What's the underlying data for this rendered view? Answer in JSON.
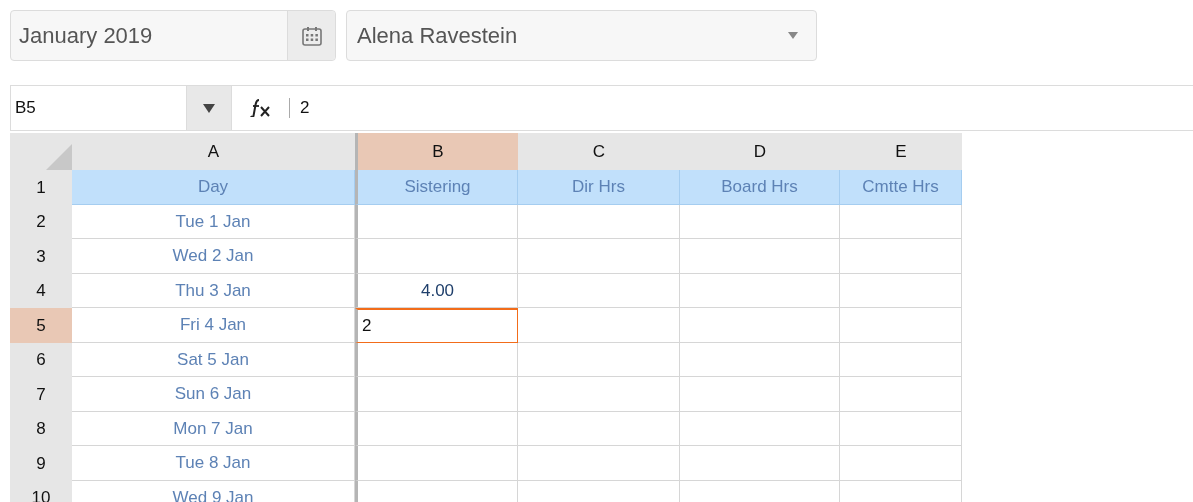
{
  "period_picker": {
    "value": "January 2019"
  },
  "person_select": {
    "value": "Alena Ravestein"
  },
  "formula_bar": {
    "cell_name": "B5",
    "formula": "2"
  },
  "columns": [
    {
      "letter": "A",
      "selected": false
    },
    {
      "letter": "B",
      "selected": true
    },
    {
      "letter": "C",
      "selected": false
    },
    {
      "letter": "D",
      "selected": false
    },
    {
      "letter": "E",
      "selected": false
    }
  ],
  "rows": [
    {
      "number": "1",
      "kind": "header",
      "selected": false,
      "cells": {
        "A": {
          "text": "Day",
          "selected": false
        },
        "B": {
          "text": "Sistering",
          "selected": false
        },
        "C": {
          "text": "Dir Hrs",
          "selected": false
        },
        "D": {
          "text": "Board Hrs",
          "selected": false
        },
        "E": {
          "text": "Cmtte Hrs",
          "selected": false
        }
      }
    },
    {
      "number": "2",
      "kind": "data",
      "selected": false,
      "cells": {
        "A": {
          "text": "Tue 1 Jan",
          "selected": false
        }
      }
    },
    {
      "number": "3",
      "kind": "data",
      "selected": false,
      "cells": {
        "A": {
          "text": "Wed 2 Jan",
          "selected": false
        }
      }
    },
    {
      "number": "4",
      "kind": "data",
      "selected": false,
      "cells": {
        "A": {
          "text": "Thu 3 Jan",
          "selected": false
        },
        "B": {
          "text": "4.00",
          "selected": false
        }
      }
    },
    {
      "number": "5",
      "kind": "data",
      "selected": true,
      "cells": {
        "A": {
          "text": "Fri 4 Jan",
          "selected": false
        },
        "B": {
          "text": "2",
          "selected": true
        }
      }
    },
    {
      "number": "6",
      "kind": "data",
      "selected": false,
      "cells": {
        "A": {
          "text": "Sat 5 Jan",
          "selected": false
        }
      }
    },
    {
      "number": "7",
      "kind": "data",
      "selected": false,
      "cells": {
        "A": {
          "text": "Sun 6 Jan",
          "selected": false
        }
      }
    },
    {
      "number": "8",
      "kind": "data",
      "selected": false,
      "cells": {
        "A": {
          "text": "Mon 7 Jan",
          "selected": false
        }
      }
    },
    {
      "number": "9",
      "kind": "data",
      "selected": false,
      "cells": {
        "A": {
          "text": "Tue 8 Jan",
          "selected": false
        }
      }
    },
    {
      "number": "10",
      "kind": "data",
      "selected": false,
      "cells": {
        "A": {
          "text": "Wed 9 Jan",
          "selected": false
        }
      }
    }
  ]
}
